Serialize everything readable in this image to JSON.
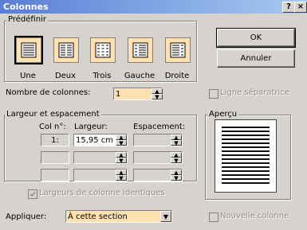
{
  "window": {
    "title": "Colonnes",
    "help": "?",
    "close": "×"
  },
  "predefinir": {
    "label": "Prédéfinir",
    "presets": [
      {
        "label": "Une"
      },
      {
        "label": "Deux"
      },
      {
        "label": "Trois"
      },
      {
        "label": "Gauche"
      },
      {
        "label": "Droite"
      }
    ]
  },
  "buttons": {
    "ok": "OK",
    "annuler": "Annuler"
  },
  "nombre": {
    "label": "Nombre de colonnes:",
    "value": "1"
  },
  "ligne": {
    "label": "Ligne séparatrice"
  },
  "largeur_group": {
    "label": "Largeur et espacement",
    "col_header": "Col n°:",
    "largeur_header": "Largeur:",
    "espacement_header": "Espacement:",
    "rows": [
      {
        "col": "1:",
        "largeur": "15,95 cm",
        "espacement": ""
      },
      {
        "col": "",
        "largeur": "",
        "espacement": ""
      },
      {
        "col": "",
        "largeur": "",
        "espacement": ""
      }
    ],
    "identiques": "Largeurs de colonne identiques"
  },
  "apercu": {
    "label": "Aperçu"
  },
  "appliquer": {
    "label": "Appliquer:",
    "value": "À cette section"
  },
  "nouvelle": {
    "label": "Nouvelle colonne"
  }
}
